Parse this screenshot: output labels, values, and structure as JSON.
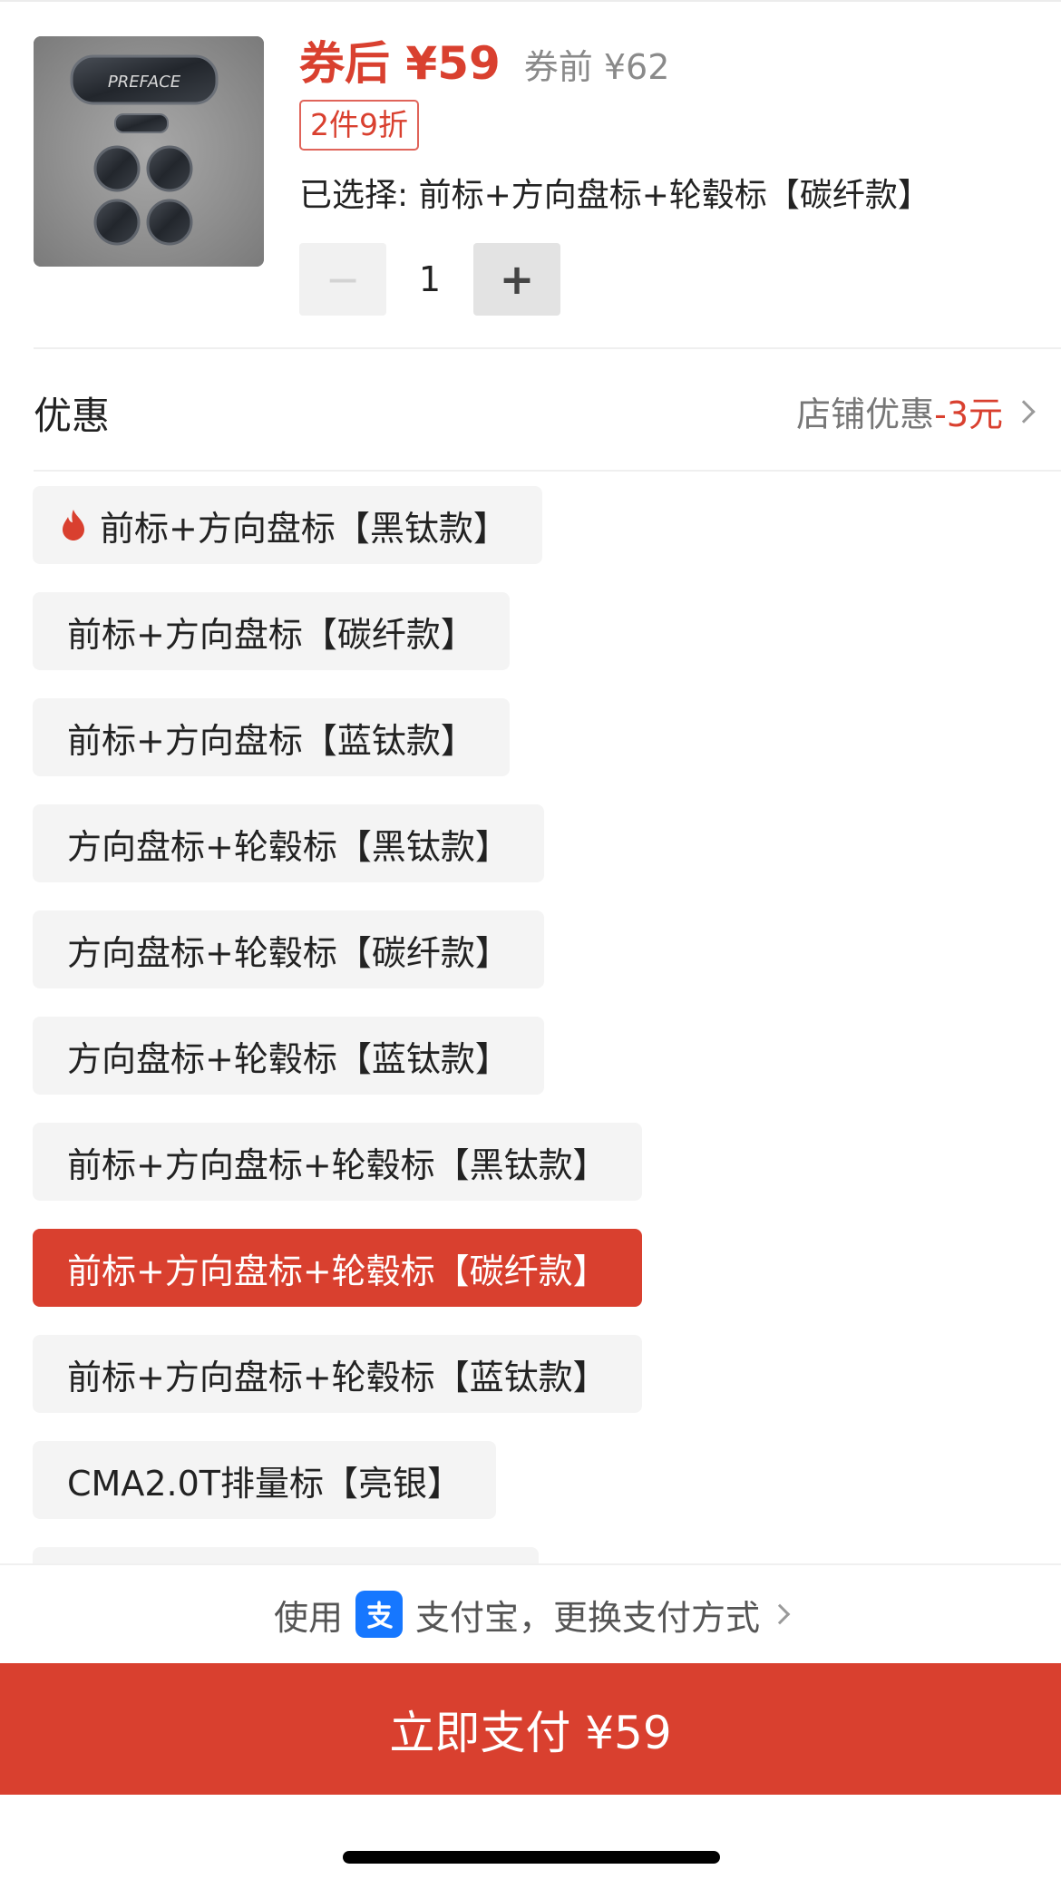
{
  "product": {
    "price_after": "券后 ¥59",
    "price_before": "券前 ¥62",
    "discount_badge": "2件9折",
    "selected": "已选择: 前标+方向盘标+轮毂标【碳纤款】",
    "image_icon": "product-thumbnail",
    "image_text": "PREFACE"
  },
  "quantity": {
    "minus": "−",
    "value": "1",
    "plus": "+"
  },
  "promo": {
    "title": "优惠",
    "label": "店铺优惠",
    "value": "-3元"
  },
  "variants": [
    {
      "label": "前标+方向盘标【黑钛款】",
      "hot": true,
      "selected": false
    },
    {
      "label": "前标+方向盘标【碳纤款】",
      "hot": false,
      "selected": false
    },
    {
      "label": "前标+方向盘标【蓝钛款】",
      "hot": false,
      "selected": false
    },
    {
      "label": "方向盘标+轮毂标【黑钛款】",
      "hot": false,
      "selected": false
    },
    {
      "label": "方向盘标+轮毂标【碳纤款】",
      "hot": false,
      "selected": false
    },
    {
      "label": "方向盘标+轮毂标【蓝钛款】",
      "hot": false,
      "selected": false
    },
    {
      "label": "前标+方向盘标+轮毂标【黑钛款】",
      "hot": false,
      "selected": false
    },
    {
      "label": "前标+方向盘标+轮毂标【碳纤款】",
      "hot": false,
      "selected": true
    },
    {
      "label": "前标+方向盘标+轮毂标【蓝钛款】",
      "hot": false,
      "selected": false
    },
    {
      "label": "CMA2.0T排量标【亮银】",
      "hot": false,
      "selected": false
    }
  ],
  "payment": {
    "prefix": "使用",
    "method": "支付宝，更换支付方式",
    "icon": "alipay-icon",
    "button": "立即支付 ¥59"
  },
  "colors": {
    "accent": "#d9402f",
    "alipay": "#1677ff"
  }
}
